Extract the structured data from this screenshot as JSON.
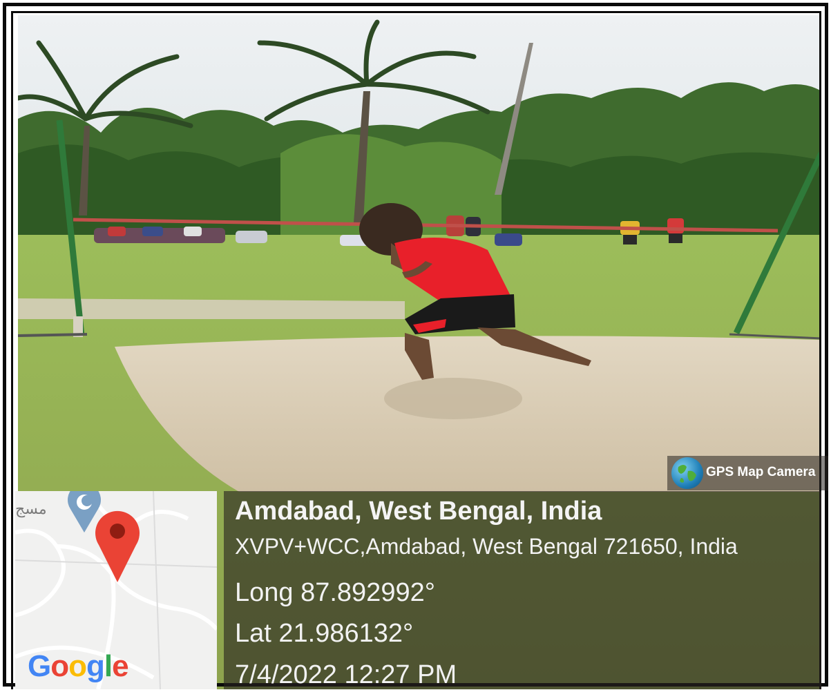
{
  "badge": {
    "label": "GPS Map Camera",
    "icon": "globe-icon"
  },
  "location": {
    "title": "Amdabad, West Bengal, India",
    "address": "XVPV+WCC,Amdabad, West Bengal 721650, India",
    "longitude": "Long 87.892992°",
    "latitude": "Lat 21.986132°",
    "datetime": "7/4/2022 12:27 PM"
  },
  "map": {
    "brand": [
      "G",
      "o",
      "o",
      "g",
      "l",
      "e"
    ],
    "place_label": "مسج",
    "pin_color": "#EA4335"
  }
}
